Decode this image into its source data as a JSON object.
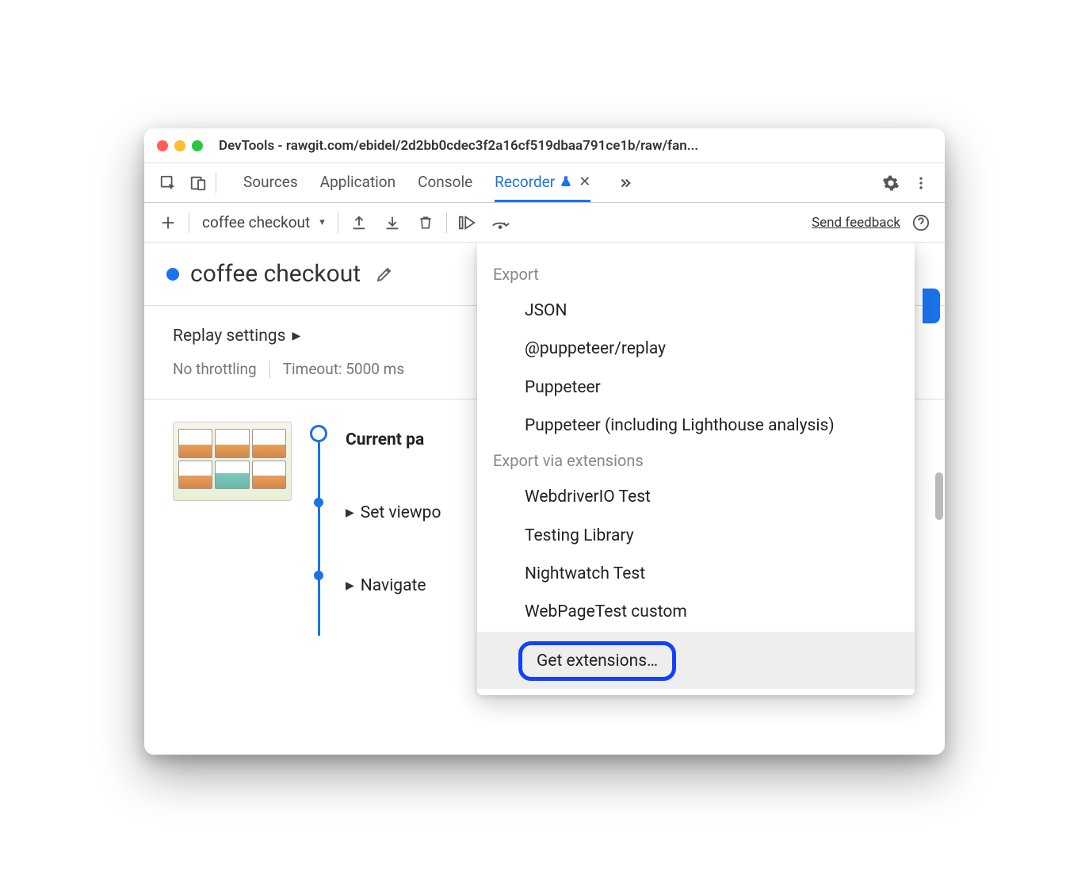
{
  "window": {
    "title": "DevTools - rawgit.com/ebidel/2d2bb0cdec3f2a16cf519dbaa791ce1b/raw/fan..."
  },
  "tabs": {
    "sources": "Sources",
    "application": "Application",
    "console": "Console",
    "recorder": "Recorder"
  },
  "toolbar": {
    "recording_name": "coffee checkout",
    "send_feedback": "Send feedback"
  },
  "recording": {
    "title": "coffee checkout"
  },
  "settings": {
    "heading": "Replay settings",
    "throttling": "No throttling",
    "timeout": "Timeout: 5000 ms"
  },
  "steps": {
    "current": "Current pa",
    "set_viewport": "Set viewpo",
    "navigate": "Navigate"
  },
  "export_menu": {
    "section_export": "Export",
    "json": "JSON",
    "puppeteer_replay": "@puppeteer/replay",
    "puppeteer": "Puppeteer",
    "puppeteer_lh": "Puppeteer (including Lighthouse analysis)",
    "section_ext": "Export via extensions",
    "webdriverio": "WebdriverIO Test",
    "testing_library": "Testing Library",
    "nightwatch": "Nightwatch Test",
    "webpagetest": "WebPageTest custom",
    "get_extensions": "Get extensions…"
  }
}
